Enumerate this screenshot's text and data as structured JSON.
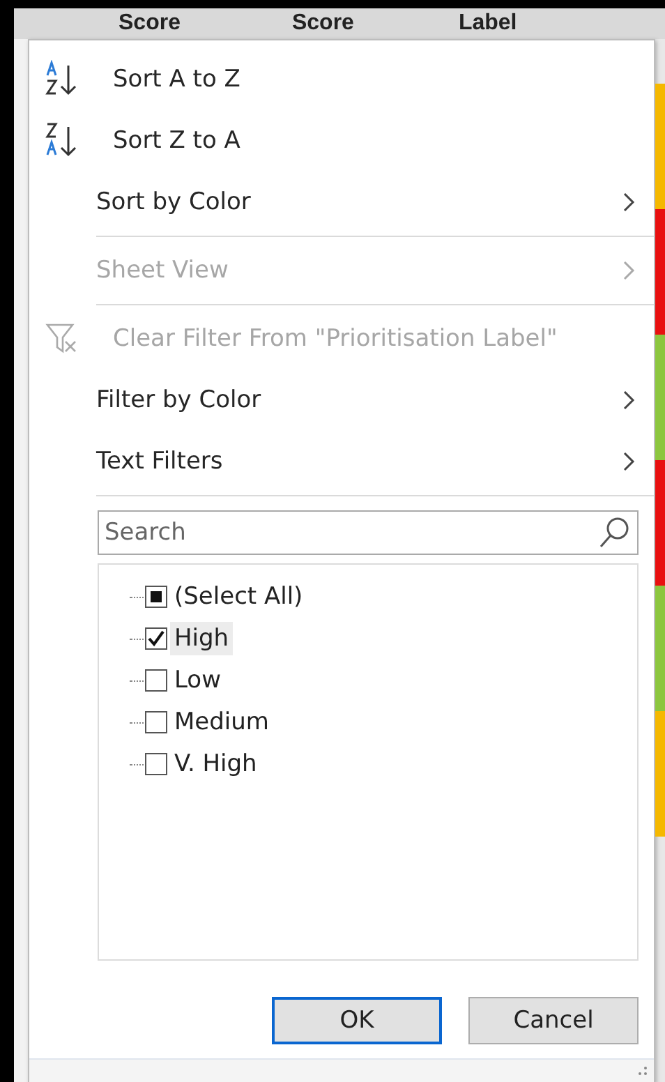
{
  "header": {
    "columns": [
      "Score",
      "Score",
      "Label"
    ]
  },
  "menu": {
    "items": [
      {
        "kind": "sort_ascending",
        "label": "Sort A to Z",
        "disabled": false,
        "submenu": false
      },
      {
        "kind": "sort_descending",
        "label": "Sort Z to A",
        "disabled": false,
        "submenu": false
      },
      {
        "kind": "item",
        "label": "Sort by Color",
        "disabled": false,
        "submenu": true
      },
      {
        "kind": "separator"
      },
      {
        "kind": "item",
        "label": "Sheet View",
        "disabled": true,
        "submenu": true
      },
      {
        "kind": "separator"
      },
      {
        "kind": "clear_filter",
        "label": "Clear Filter From \"Prioritisation Label\"",
        "disabled": true,
        "submenu": false
      },
      {
        "kind": "item",
        "label": "Filter by Color",
        "disabled": false,
        "submenu": true
      },
      {
        "kind": "item",
        "label": "Text Filters",
        "disabled": false,
        "submenu": true
      },
      {
        "kind": "separator"
      }
    ]
  },
  "search": {
    "placeholder": "Search"
  },
  "values": [
    {
      "label": "(Select All)",
      "checked": false,
      "mixed": true,
      "highlighted": false
    },
    {
      "label": "High",
      "checked": true,
      "mixed": false,
      "highlighted": true
    },
    {
      "label": "Low",
      "checked": false,
      "mixed": false,
      "highlighted": false
    },
    {
      "label": "Medium",
      "checked": false,
      "mixed": false,
      "highlighted": false
    },
    {
      "label": "V. High",
      "checked": false,
      "mixed": false,
      "highlighted": false
    }
  ],
  "buttons": [
    {
      "label": "OK",
      "default": true
    },
    {
      "label": "Cancel",
      "default": false
    }
  ],
  "side_cells": [
    {
      "color": "#f5b800"
    },
    {
      "color": "#e81010"
    },
    {
      "color": "#8cc63f"
    },
    {
      "color": "#e81010"
    },
    {
      "color": "#8cc63f"
    },
    {
      "color": "#f5b800"
    }
  ]
}
